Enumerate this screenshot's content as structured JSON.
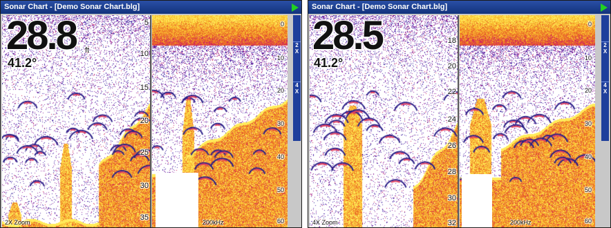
{
  "windows": [
    {
      "title": "Sonar Chart - [Demo Sonar Chart.blg]",
      "depth": "28.8",
      "depth_unit": "ft",
      "temperature": "41.2°",
      "zoom_label": "2X Zoom",
      "freq_label": "200kHz",
      "zoom_scale": [
        "5",
        "10",
        "15",
        "20",
        "25",
        "30",
        "35"
      ],
      "full_scale": [
        "0",
        "10",
        "20",
        "30",
        "40",
        "50",
        "60"
      ],
      "zoom_buttons": [
        "2 X",
        "4 X"
      ]
    },
    {
      "title": "Sonar Chart - [Demo Sonar Chart.blg]",
      "depth": "28.5",
      "depth_unit": "",
      "temperature": "41.2°",
      "zoom_label": "4X Zoom",
      "freq_label": "200kHz",
      "zoom_scale": [
        "18",
        "20",
        "22",
        "24",
        "26",
        "28",
        "30",
        "32"
      ],
      "full_scale": [
        "0",
        "10",
        "20",
        "30",
        "40",
        "50",
        "60"
      ],
      "zoom_buttons": [
        "2 X",
        "4 X"
      ]
    }
  ],
  "colors": {
    "titlebar": "#1c3f94",
    "zoom_bar": "#1f3f9c",
    "play_button": "#22d022"
  },
  "icons": [
    "play-icon"
  ]
}
